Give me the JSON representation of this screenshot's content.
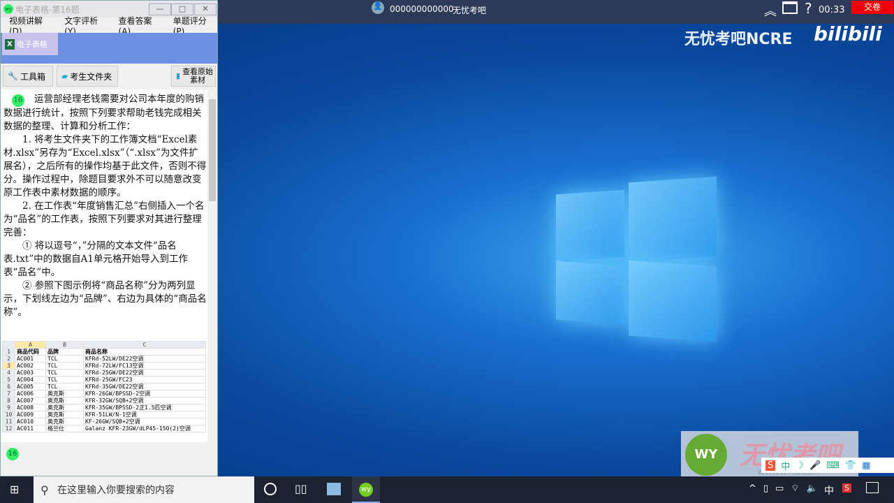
{
  "window": {
    "title": "电子表格-第16题",
    "minimize": "—",
    "maximize": "□",
    "close": "✕"
  },
  "menu": [
    "视频讲解(D)",
    "文字评析(Y)",
    "查看答案(A)",
    "单题评分(P)"
  ],
  "tab": {
    "label": "电子表格"
  },
  "toolbar": {
    "tools": "工具箱",
    "folder": "考生文件夹",
    "original_line1": "查看原始",
    "original_line2": "素材"
  },
  "question": {
    "number": "16",
    "paragraphs": [
      "运营部经理老钱需要对公司本年度的购销数据进行统计，按照下列要求帮助老钱完成相关数据的整理、计算和分析工作：",
      "1. 将考生文件夹下的工作簿文档“Excel素材.xlsx”另存为“Excel.xlsx”（“.xlsx”为文件扩展名），之后所有的操作均基于此文件，否则不得分。操作过程中，除题目要求外不可以随意改变原工作表中素材数据的顺序。",
      "2. 在工作表“年度销售汇总”右侧插入一个名为“品名”的工作表，按照下列要求对其进行整理完善：",
      "① 将以逗号“，”分隔的文本文件“品名表.txt”中的数据自A1单元格开始导入到工作表“品名”中。",
      "② 参照下图示例将“商品名称”分为两列显示，下划线左边为“品牌”、右边为具体的“商品名称”。"
    ]
  },
  "sheet": {
    "cols": [
      "A",
      "B",
      "C"
    ],
    "rows": [
      [
        "商品代码",
        "品牌",
        "商品名称"
      ],
      [
        "AC001",
        "TCL",
        "KFRd-52LW/DE22空调"
      ],
      [
        "AC002",
        "TCL",
        "KFRd-72LW/FC13空调"
      ],
      [
        "AC003",
        "TCL",
        "KFRd-25GW/DE22空调"
      ],
      [
        "AC004",
        "TCL",
        "KFRd-25GW/FC23"
      ],
      [
        "AC005",
        "TCL",
        "KFRd-35GW/DE22空调"
      ],
      [
        "AC006",
        "奥克斯",
        "KFR-26GW/BPSSD-2空调"
      ],
      [
        "AC007",
        "奥克斯",
        "KFR-32GW/SQB+2空调"
      ],
      [
        "AC008",
        "奥克斯",
        "KFR-35GW/BPSSD-2正1.5匹空调"
      ],
      [
        "AC009",
        "奥克斯",
        "KFR-51LW/N-1空调"
      ],
      [
        "AC010",
        "奥克斯",
        "KF-26GW/SQB+2空调"
      ],
      [
        "AC011",
        "格兰仕",
        "Galanz KFR-23GW/dLP45-150(2)空调"
      ]
    ]
  },
  "footer_badge": "16",
  "topbar": {
    "user": "000000000000",
    "brand": "无忧考吧",
    "timer": "00:33",
    "submit": "交卷",
    "help": "?"
  },
  "watermark": {
    "text": "无忧考吧NCRE",
    "site": "bilibili",
    "logo": "WY",
    "logo_text": "无忧考吧",
    "logo_url": "WWW.WYKB.COM"
  },
  "taskbar": {
    "search_placeholder": "在这里输入你要搜索的内容",
    "ime": "中",
    "app": "wy"
  }
}
